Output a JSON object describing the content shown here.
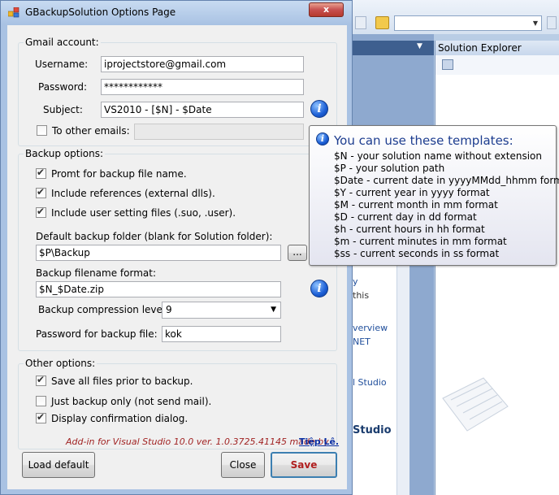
{
  "background": {
    "solution_explorer_title": "Solution Explorer",
    "startpage_fragments": [
      "y",
      "this",
      "verview",
      "NET",
      "l Studio",
      "Studio"
    ]
  },
  "dialog": {
    "title": "GBackupSolution Options Page",
    "close_glyph": "x",
    "gmail": {
      "legend": "Gmail account:",
      "username_label": "Username:",
      "username_value": "iprojectstore@gmail.com",
      "password_label": "Password:",
      "password_value": "************",
      "subject_label": "Subject:",
      "subject_value": "VS2010 - [$N] - $Date",
      "other_emails_label": "To other emails:",
      "other_emails_value": "",
      "other_emails_checked": false
    },
    "backup": {
      "legend": "Backup options:",
      "prompt_label": "Promt for backup file name.",
      "prompt_checked": true,
      "include_refs_label": "Include references (external dlls).",
      "include_refs_checked": true,
      "include_user_label": "Include user setting files (.suo, .user).",
      "include_user_checked": true,
      "folder_label": "Default backup folder (blank for Solution folder):",
      "folder_value": "$P\\Backup",
      "browse_label": "...",
      "filename_label": "Backup filename format:",
      "filename_value": "$N_$Date.zip",
      "compression_label": "Backup compression level:",
      "compression_value": "9",
      "zip_password_label": "Password for backup file:",
      "zip_password_value": "kok"
    },
    "other": {
      "legend": "Other options:",
      "save_all_label": "Save all files prior to backup.",
      "save_all_checked": true,
      "just_backup_label": "Just backup only (not send mail).",
      "just_backup_checked": false,
      "confirm_label": "Display confirmation dialog.",
      "confirm_checked": true
    },
    "credit_text": "Add-in for Visual Studio 10.0 ver. 1.0.3725.41145 made by",
    "author_link": "Tiệp Lê.",
    "buttons": {
      "load_default": "Load default",
      "close": "Close",
      "save": "Save"
    }
  },
  "tooltip": {
    "title": "You can use these templates:",
    "lines": [
      "$N - your solution name without extension",
      "$P - your solution path",
      "$Date - current date in yyyyMMdd_hhmm format",
      "$Y - current year in yyyy format",
      "$M - current month in mm format",
      "$D - current day in dd format",
      "$h - current hours in hh format",
      "$m - current minutes in mm format",
      "$ss - current seconds in ss format"
    ]
  },
  "colors": {
    "credit_text": "#a12424",
    "author_link": "#0a2fa3",
    "tooltip_title": "#1d3d8f",
    "save_text": "#b01e1e"
  }
}
